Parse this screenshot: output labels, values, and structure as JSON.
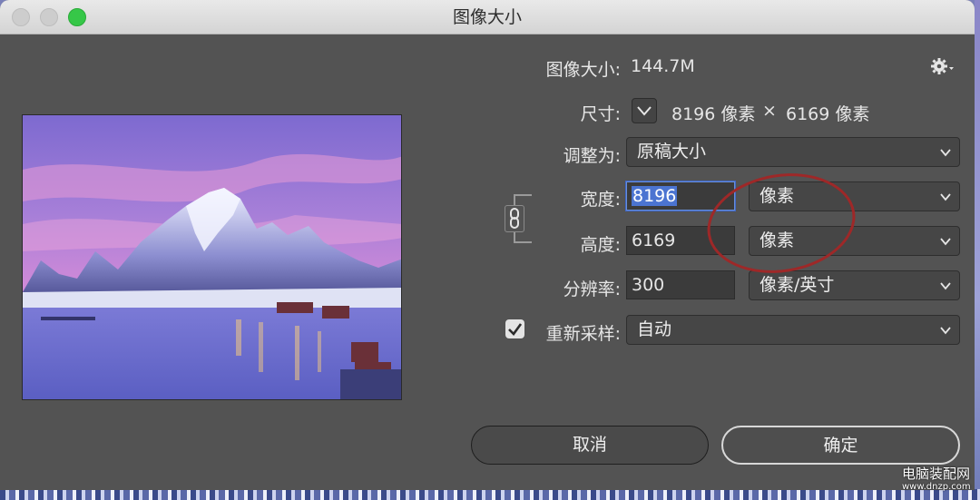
{
  "window": {
    "title": "图像大小"
  },
  "info": {
    "image_size_label": "图像大小:",
    "image_size_value": "144.7M"
  },
  "dimensions": {
    "label": "尺寸:",
    "width": "8196 像素",
    "times": "×",
    "height": "6169 像素"
  },
  "fit_to": {
    "label": "调整为:",
    "value": "原稿大小"
  },
  "width_field": {
    "label": "宽度:",
    "value": "8196",
    "unit": "像素"
  },
  "height_field": {
    "label": "高度:",
    "value": "6169",
    "unit": "像素"
  },
  "resolution_field": {
    "label": "分辨率:",
    "value": "300",
    "unit": "像素/英寸"
  },
  "resample": {
    "label": "重新采样:",
    "checked": true,
    "value": "自动"
  },
  "buttons": {
    "cancel": "取消",
    "ok": "确定"
  },
  "watermark": {
    "name": "电脑装配网",
    "url": "www.dnzp.com"
  },
  "icons": {
    "gear": "gear-icon",
    "chevron": "chevron-down-icon",
    "link": "link-icon",
    "check": "checkmark-icon"
  },
  "colors": {
    "dialog_bg": "#535353",
    "field_bg": "#3b3b3b",
    "selection": "#4b74d1",
    "annotation": "#9e2828",
    "zoom_button": "#36c748"
  }
}
